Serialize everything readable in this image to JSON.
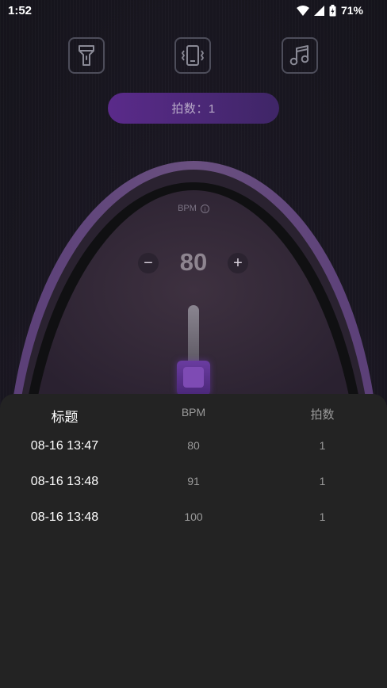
{
  "status_bar": {
    "time": "1:52",
    "battery": "71%"
  },
  "toolbar": {
    "icons": [
      "flashlight-icon",
      "vibrate-icon",
      "music-note-icon"
    ]
  },
  "beat_pill": {
    "label": "拍数：1"
  },
  "metronome": {
    "bpm_label": "BPM",
    "info_glyph": "i",
    "minus": "−",
    "plus": "+",
    "bpm_value": "80",
    "slider_level": 0.3
  },
  "presets_sheet": {
    "columns": [
      "标题",
      "BPM",
      "拍数"
    ],
    "rows": [
      {
        "title": "08-16 13:47",
        "bpm": "80",
        "beats": "1"
      },
      {
        "title": "08-16 13:48",
        "bpm": "91",
        "beats": "1"
      },
      {
        "title": "08-16 13:48",
        "bpm": "100",
        "beats": "1"
      }
    ]
  },
  "colors": {
    "accent": "#5a2a8a",
    "sheet_bg": "#232323",
    "background": "#16141d"
  }
}
